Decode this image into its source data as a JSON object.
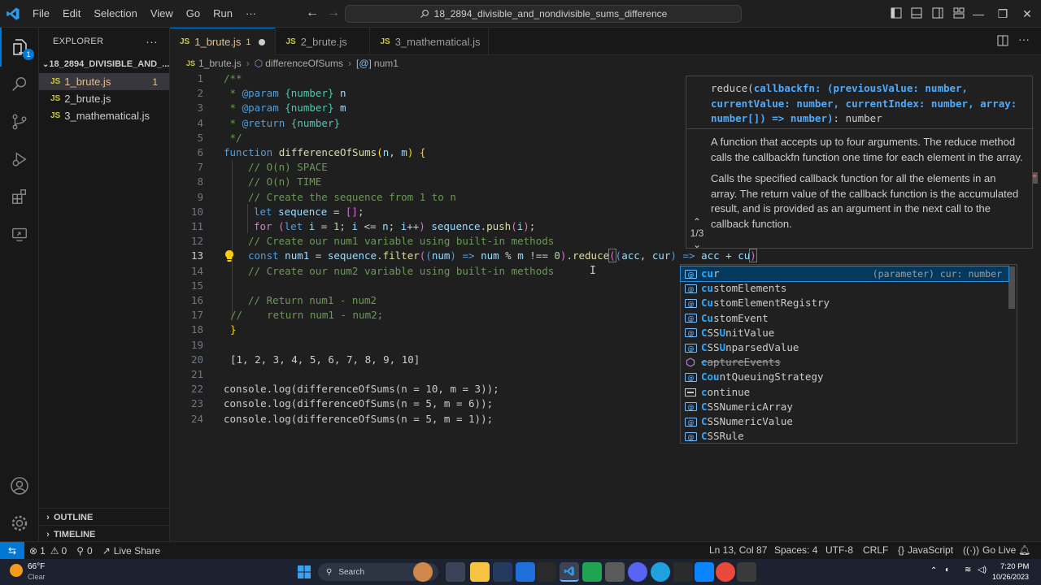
{
  "titlebar": {
    "menus": [
      "File",
      "Edit",
      "Selection",
      "View",
      "Go",
      "Run",
      "···"
    ],
    "search": "18_2894_divisible_and_nondivisible_sums_difference"
  },
  "explorer": {
    "title": "EXPLORER",
    "more": "···",
    "folder": "18_2894_DIVISIBLE_AND_...",
    "files": [
      {
        "name": "1_brute.js",
        "icon": "JS",
        "count": "1"
      },
      {
        "name": "2_brute.js",
        "icon": "JS",
        "count": ""
      },
      {
        "name": "3_mathematical.js",
        "icon": "JS",
        "count": ""
      }
    ],
    "outline": "OUTLINE",
    "timeline": "TIMELINE"
  },
  "tabs": [
    {
      "name": "1_brute.js",
      "icon": "JS",
      "modified": "1"
    },
    {
      "name": "2_brute.js",
      "icon": "JS"
    },
    {
      "name": "3_mathematical.js",
      "icon": "JS"
    }
  ],
  "breadcrumb": {
    "file": "1_brute.js",
    "func": "differenceOfSums",
    "var": "num1"
  },
  "code": {
    "line_numbers": [
      "1",
      "2",
      "3",
      "4",
      "5",
      "6",
      "7",
      "8",
      "9",
      "10",
      "11",
      "12",
      "13",
      "14",
      "15",
      "16",
      "17",
      "18",
      "19",
      "20",
      "21",
      "22",
      "23",
      "24"
    ],
    "l1": "/**",
    "l2a": " * ",
    "l2b": "@param",
    "l2c": " {number} ",
    "l2d": "n",
    "l3a": " * ",
    "l3b": "@param",
    "l3c": " {number} ",
    "l3d": "m",
    "l4a": " * ",
    "l4b": "@return",
    "l4c": " {number}",
    "l5": " */",
    "l6a": "function",
    "l6b": "differenceOfSums",
    "l6c": "n",
    "l6d": "m",
    "l7": "// O(n) SPACE",
    "l8": "// O(n) TIME",
    "l9": "// Create the sequence from 1 to n",
    "l10a": "let",
    "l10b": "sequence",
    "l11a": "for",
    "l11b": "let",
    "l11c": "i",
    "l11d": "1",
    "l11e": "i",
    "l11f": "n",
    "l11g": "i",
    "l11h": "sequence",
    "l11i": "push",
    "l11j": "i",
    "l12": "// Create our num1 variable using built-in methods",
    "l13a": "const",
    "l13b": "num1",
    "l13c": "sequence",
    "l13d": "filter",
    "l13e": "num",
    "l13f": "num",
    "l13g": "m",
    "l13h": "0",
    "l13i": "reduce",
    "l13j": "acc",
    "l13k": "cur",
    "l13l": "acc",
    "l13m": "cu",
    "l14": "// Create our num2 variable using built-in methods",
    "l16": "// Return num1 - num2",
    "l17": "//    return num1 - num2;",
    "l18": "}",
    "l20": "[1, 2, 3, 4, 5, 6, 7, 8, 9, 10]",
    "l22": "console.log(differenceOfSums(n = 10, m = 3));",
    "l23": "console.log(differenceOfSums(n = 5, m = 6));",
    "l24": "console.log(differenceOfSums(n = 5, m = 1));"
  },
  "signature": {
    "line1a": "reduce(",
    "line1b": "callbackfn: (previousValue: number,",
    "line2": "currentValue: number, currentIndex: number, array:",
    "line3a": "number[]) => number)",
    "line3b": ": number",
    "doc1": "A function that accepts up to four arguments. The reduce method calls the callbackfn function one time for each element in the array.",
    "doc2": "Calls the specified callback function for all the elements in an array. The return value of the callback function is the accumulated result, and is provided as an argument in the next call to the callback function.",
    "nav": "1/3"
  },
  "suggest": {
    "items": [
      {
        "m": "cu",
        "rest": "r",
        "detail": "(parameter) cur: number",
        "kind": "variable"
      },
      {
        "m": "cu",
        "rest": "stomElements",
        "kind": "variable"
      },
      {
        "m": "Cu",
        "rest": "stomElementRegistry",
        "kind": "variable"
      },
      {
        "m": "Cu",
        "rest": "stomEvent",
        "kind": "variable"
      },
      {
        "m": "C",
        "rest2": "SSU",
        "rest": "nitValue",
        "kind": "variable"
      },
      {
        "m": "C",
        "rest2": "SSU",
        "rest": "nparsedValue",
        "kind": "variable"
      },
      {
        "m": "c",
        "rest": "aptureEvents",
        "kind": "method",
        "deprecated": true
      },
      {
        "m": "Cou",
        "rest": "ntQueuingStrategy",
        "kind": "variable"
      },
      {
        "m": "c",
        "rest": "ontinue",
        "kind": "keyword"
      },
      {
        "m": "C",
        "rest": "SSNumericArray",
        "kind": "variable"
      },
      {
        "m": "C",
        "rest": "SSNumericValue",
        "kind": "variable"
      },
      {
        "m": "C",
        "rest": "SSRule",
        "kind": "variable"
      }
    ]
  },
  "status": {
    "errors": "1",
    "warnings": "0",
    "ports": "0",
    "liveshare": "Live Share",
    "position": "Ln 13, Col 87",
    "spaces": "Spaces: 4",
    "encoding": "UTF-8",
    "eol": "CRLF",
    "language": "JavaScript",
    "golive": "Go Live"
  },
  "taskbar": {
    "temp": "66°F",
    "weather": "Clear",
    "search": "Search",
    "time": "7:20 PM",
    "date": "10/26/2023"
  },
  "colors": {
    "accent": "#0078d4",
    "modified": "#e2c08d",
    "js": "#cbcb41"
  }
}
